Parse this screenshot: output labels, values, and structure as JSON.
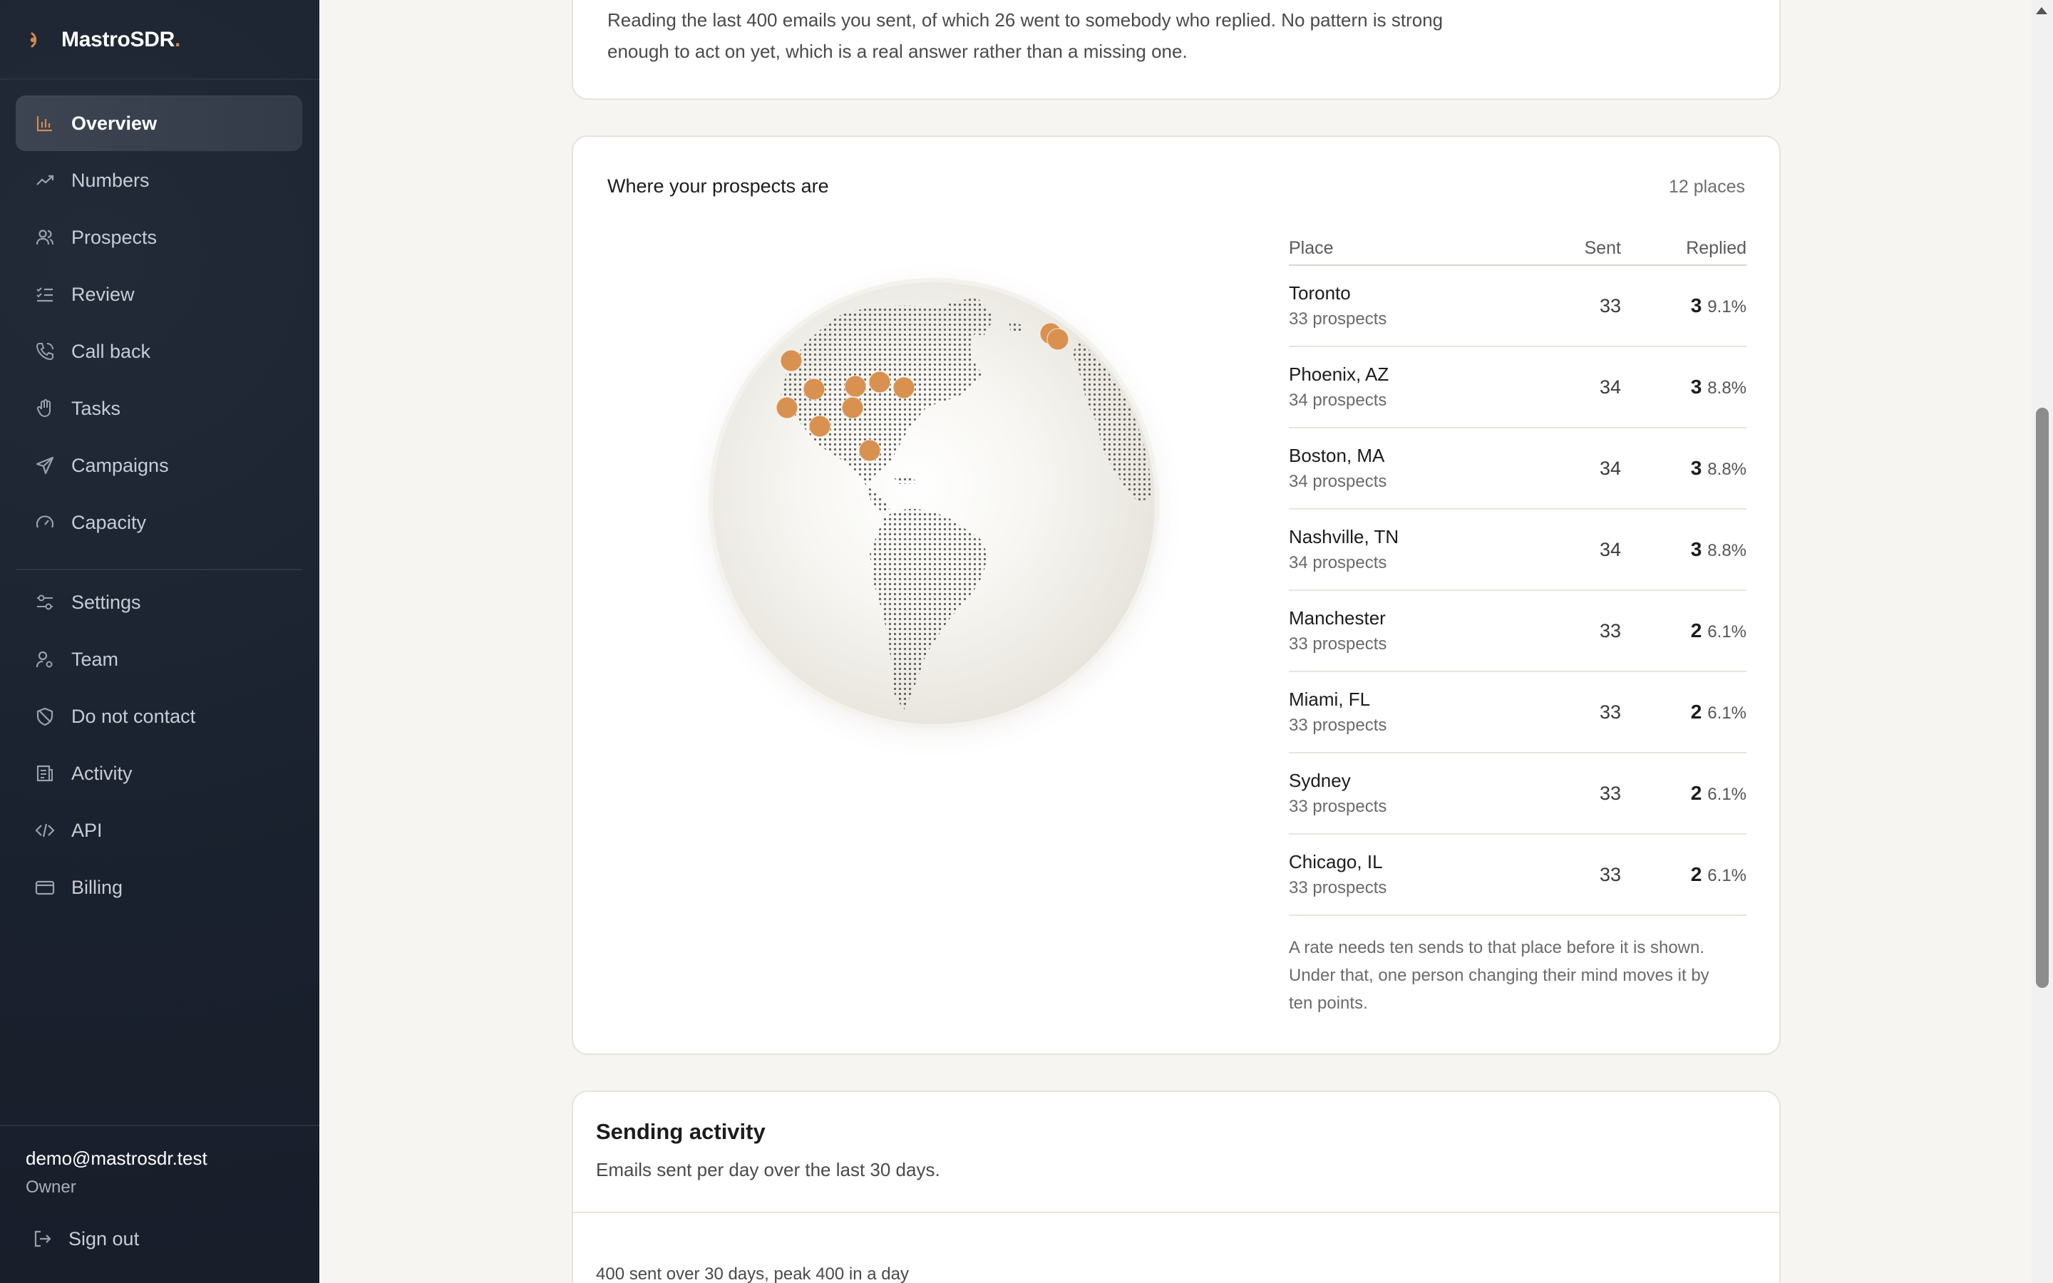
{
  "app": {
    "name": "MastroSDR",
    "name_dot": "."
  },
  "sidebar": {
    "items": [
      {
        "label": "Overview",
        "icon": "bar-chart-icon",
        "active": true
      },
      {
        "label": "Numbers",
        "icon": "trend-line-icon"
      },
      {
        "label": "Prospects",
        "icon": "users-icon"
      },
      {
        "label": "Review",
        "icon": "checklist-icon"
      },
      {
        "label": "Call back",
        "icon": "phone-icon"
      },
      {
        "label": "Tasks",
        "icon": "hand-icon"
      },
      {
        "label": "Campaigns",
        "icon": "send-icon"
      },
      {
        "label": "Capacity",
        "icon": "gauge-icon"
      }
    ],
    "secondary": [
      {
        "label": "Settings",
        "icon": "sliders-icon"
      },
      {
        "label": "Team",
        "icon": "user-cog-icon"
      },
      {
        "label": "Do not contact",
        "icon": "shield-off-icon"
      },
      {
        "label": "Activity",
        "icon": "log-icon"
      },
      {
        "label": "API",
        "icon": "code-icon"
      },
      {
        "label": "Billing",
        "icon": "card-icon"
      }
    ],
    "user": {
      "email": "demo@mastrosdr.test",
      "role": "Owner"
    },
    "signout": "Sign out"
  },
  "insight": {
    "text": "Reading the last 400 emails you sent, of which 26 went to somebody who replied. No pattern is strong enough to act on yet, which is a real answer rather than a missing one."
  },
  "places": {
    "title": "Where your prospects are",
    "count": "12 places",
    "columns": {
      "place": "Place",
      "sent": "Sent",
      "replied": "Replied"
    },
    "rows": [
      {
        "name": "Toronto",
        "sub": "33 prospects",
        "sent": "33",
        "replied": "3",
        "rate": "9.1%"
      },
      {
        "name": "Phoenix, AZ",
        "sub": "34 prospects",
        "sent": "34",
        "replied": "3",
        "rate": "8.8%"
      },
      {
        "name": "Boston, MA",
        "sub": "34 prospects",
        "sent": "34",
        "replied": "3",
        "rate": "8.8%"
      },
      {
        "name": "Nashville, TN",
        "sub": "34 prospects",
        "sent": "34",
        "replied": "3",
        "rate": "8.8%"
      },
      {
        "name": "Manchester",
        "sub": "33 prospects",
        "sent": "33",
        "replied": "2",
        "rate": "6.1%"
      },
      {
        "name": "Miami, FL",
        "sub": "33 prospects",
        "sent": "33",
        "replied": "2",
        "rate": "6.1%"
      },
      {
        "name": "Sydney",
        "sub": "33 prospects",
        "sent": "33",
        "replied": "2",
        "rate": "6.1%"
      },
      {
        "name": "Chicago, IL",
        "sub": "33 prospects",
        "sent": "33",
        "replied": "2",
        "rate": "6.1%"
      }
    ],
    "note": "A rate needs ten sends to that place before it is shown. Under that, one person changing their mind moves it by ten points.",
    "marker_color": "#d9914f"
  },
  "activity": {
    "title": "Sending activity",
    "subtitle": "Emails sent per day over the last 30 days.",
    "summary": "400 sent over 30 days, peak 400 in a day"
  }
}
